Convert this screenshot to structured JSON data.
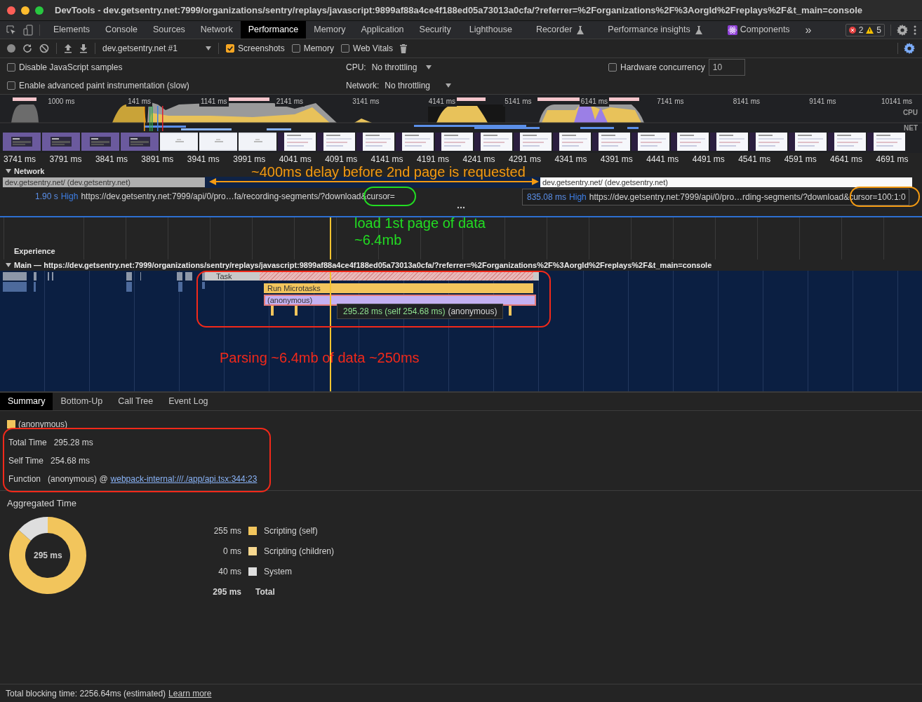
{
  "window": {
    "title": "DevTools - dev.getsentry.net:7999/organizations/sentry/replays/javascript:9899af88a4ce4f188ed05a73013a0cfa/?referrer=%2Forganizations%2F%3AorgId%2Freplays%2F&t_main=console"
  },
  "tabs": [
    {
      "label": "Elements",
      "selected": false,
      "experimental": false,
      "kind": "plain"
    },
    {
      "label": "Console",
      "selected": false,
      "experimental": false,
      "kind": "plain"
    },
    {
      "label": "Sources",
      "selected": false,
      "experimental": false,
      "kind": "plain"
    },
    {
      "label": "Network",
      "selected": false,
      "experimental": false,
      "kind": "plain"
    },
    {
      "label": "Performance",
      "selected": true,
      "experimental": false,
      "kind": "plain"
    },
    {
      "label": "Memory",
      "selected": false,
      "experimental": false,
      "kind": "plain"
    },
    {
      "label": "Application",
      "selected": false,
      "experimental": false,
      "kind": "plain"
    },
    {
      "label": "Security",
      "selected": false,
      "experimental": false,
      "kind": "plain"
    },
    {
      "label": "Lighthouse",
      "selected": false,
      "experimental": false,
      "kind": "plain"
    },
    {
      "label": "Recorder",
      "selected": false,
      "experimental": true,
      "kind": "plain"
    },
    {
      "label": "Performance insights",
      "selected": false,
      "experimental": true,
      "kind": "plain"
    },
    {
      "label": "Components",
      "selected": false,
      "experimental": false,
      "kind": "react"
    }
  ],
  "more_tabs": "»",
  "issues": {
    "errors": "2",
    "warnings": "5"
  },
  "toolbar": {
    "target": "dev.getsentry.net #1",
    "options": [
      {
        "label": "Screenshots",
        "checked": true
      },
      {
        "label": "Memory",
        "checked": false
      },
      {
        "label": "Web Vitals",
        "checked": false
      }
    ]
  },
  "settings": {
    "checkboxes": [
      {
        "label": "Disable JavaScript samples",
        "checked": false
      },
      {
        "label": "Enable advanced paint instrumentation (slow)",
        "checked": false
      }
    ],
    "cpu": {
      "label": "CPU:",
      "value": "No throttling"
    },
    "network": {
      "label": "Network:",
      "value": "No throttling"
    },
    "hardware_concurrency": {
      "label": "Hardware concurrency",
      "checked": false,
      "value": "10"
    }
  },
  "overview": {
    "ticks": [
      "1000 ms",
      "141 ms",
      "1141 ms",
      "2141 ms",
      "3141 ms",
      "4141 ms",
      "5141 ms",
      "6141 ms",
      "7141 ms",
      "8141 ms",
      "9141 ms",
      "10141 ms"
    ],
    "labels": [
      "CPU",
      "NET"
    ]
  },
  "ruler": {
    "ticks": [
      "3741 ms",
      "3791 ms",
      "3841 ms",
      "3891 ms",
      "3941 ms",
      "3991 ms",
      "4041 ms",
      "4091 ms",
      "4141 ms",
      "4191 ms",
      "4241 ms",
      "4291 ms",
      "4341 ms",
      "4391 ms",
      "4441 ms",
      "4491 ms",
      "4541 ms",
      "4591 ms",
      "4641 ms",
      "4691 ms"
    ]
  },
  "network": {
    "title": "Network",
    "expanded": true,
    "requests": [
      {
        "label": "dev.getsentry.net/ (dev.getsentry.net)",
        "duration": "1.90 s",
        "priority": "High",
        "url": "https://dev.getsentry.net:7999/api/0/pro…fa/recording-segments/?download&cursor="
      },
      {
        "label": "dev.getsentry.net/ (dev.getsentry.net)",
        "duration": "835.08 ms",
        "priority": "High",
        "url": "https://dev.getsentry.net:7999/api/0/pro…rding-segments/?download&cursor=100:1:0"
      }
    ]
  },
  "experience": {
    "title": "Experience"
  },
  "main": {
    "title": "Main — https://dev.getsentry.net:7999/organizations/sentry/replays/javascript:9899af88a4ce4f188ed05a73013a0cfa/?referrer=%2Forganizations%2F%3AorgId%2Freplays%2F&t_main=console",
    "expanded": true,
    "events": [
      {
        "label": "Task",
        "kind": "task",
        "selected": false
      },
      {
        "label": "Run Microtasks",
        "kind": "microtasks",
        "selected": false
      },
      {
        "label": "(anonymous)",
        "kind": "function",
        "selected": true
      }
    ],
    "tooltip": {
      "time": "295.28 ms (self 254.68 ms)",
      "name": "(anonymous)"
    }
  },
  "annotations": [
    {
      "text": "~400ms delay before 2nd page is requested",
      "color": "#f39a12"
    },
    {
      "text": "load 1st page of data\n~6.4mb",
      "color": "#22dd22"
    },
    {
      "text": "Parsing ~6.4mb of data ~250ms",
      "color": "#f2291a"
    }
  ],
  "details": {
    "tabs": [
      {
        "label": "Summary",
        "selected": true
      },
      {
        "label": "Bottom-Up",
        "selected": false
      },
      {
        "label": "Call Tree",
        "selected": false
      },
      {
        "label": "Event Log",
        "selected": false
      }
    ],
    "summary": {
      "name": "(anonymous)",
      "color": "#f2c55c",
      "rows": [
        {
          "label": "Total Time",
          "value": "295.28 ms"
        },
        {
          "label": "Self Time",
          "value": "254.68 ms"
        },
        {
          "label": "Function",
          "value": "(anonymous) @",
          "link": "webpack-internal:///./app/api.tsx:344:23"
        }
      ]
    },
    "aggregated": {
      "title": "Aggregated Time",
      "center": "295 ms",
      "legend": [
        {
          "value": "255 ms",
          "color": "#f2c55c"
        },
        {
          "value": "0 ms",
          "color": "#f7d88f"
        },
        {
          "value": "40 ms",
          "color": "#dedede"
        }
      ],
      "total": {
        "value": "295 ms",
        "label": "Total"
      },
      "chart_data": {
        "type": "donut",
        "categories": [
          "Scripting (self)",
          "Scripting (children)",
          "System"
        ],
        "values": [
          86.44,
          0,
          13.56
        ]
      }
    }
  },
  "status_bar": {
    "text": "Total blocking time: 2256.64ms (estimated)",
    "link": "Learn more"
  }
}
